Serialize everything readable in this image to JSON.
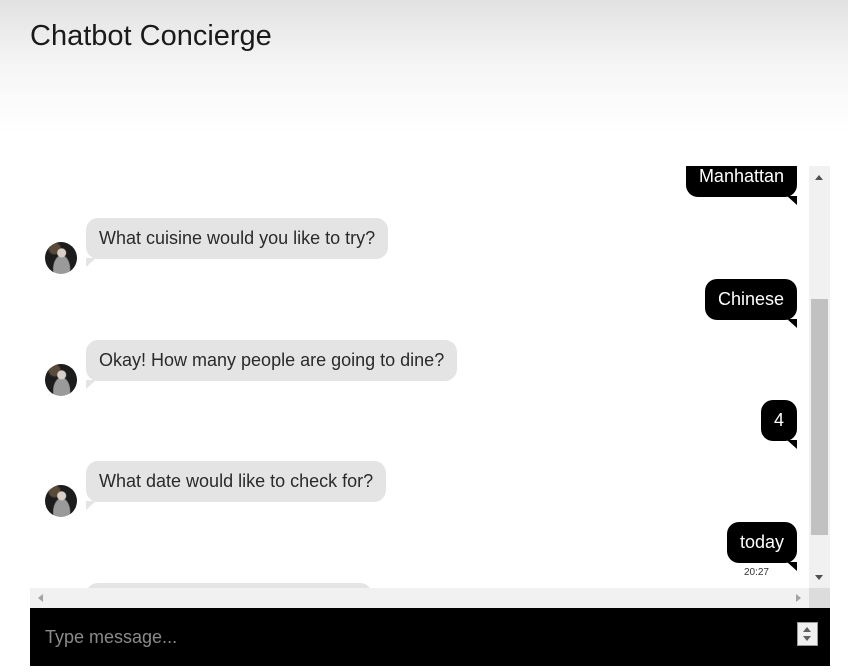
{
  "app": {
    "title": "Chatbot Concierge"
  },
  "messages": [
    {
      "sender": "user",
      "text": "Manhattan"
    },
    {
      "sender": "bot",
      "text": "What cuisine would you like to try?"
    },
    {
      "sender": "user",
      "text": "Chinese"
    },
    {
      "sender": "bot",
      "text": "Okay! How many people are going to dine?"
    },
    {
      "sender": "user",
      "text": "4"
    },
    {
      "sender": "bot",
      "text": "What date would like to check for?"
    },
    {
      "sender": "user",
      "text": "today",
      "time": "20:27"
    }
  ],
  "composer": {
    "placeholder": "Type message..."
  },
  "colors": {
    "user_bubble": "#000000",
    "bot_bubble": "#e4e4e4",
    "input_bar": "#000000"
  },
  "icons": {
    "avatar": "bot-avatar",
    "scroll_up": "scroll-up-arrow",
    "scroll_down": "scroll-down-arrow",
    "spinner": "spinner-arrows"
  }
}
